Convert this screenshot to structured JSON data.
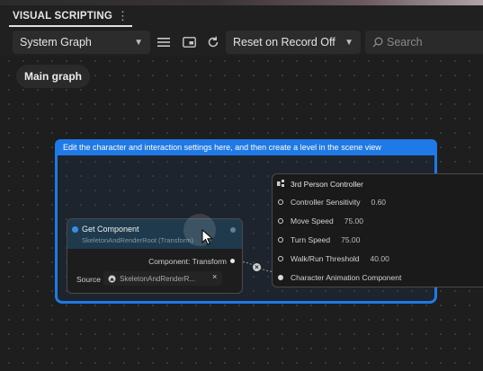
{
  "panel": {
    "title": "VISUAL SCRIPTING",
    "kebab": "⋮"
  },
  "toolbar": {
    "graph_select": "System Graph",
    "reset_select": "Reset on Record Off",
    "search_placeholder": "Search"
  },
  "breadcrumb": {
    "label": "Main graph"
  },
  "group": {
    "header": "Edit the character and interaction settings here, and then create a level in the scene view",
    "color": "#1f7ae8"
  },
  "node_get_component": {
    "title": "Get Component",
    "subtitle": "SkeletonAndRenderRoot (Transform)",
    "output_label": "Component: Transform",
    "source_label": "Source",
    "source_value": "SkeletonAndRenderR...",
    "clear": "×"
  },
  "node_controller": {
    "title": "3rd Person Controller",
    "rows": [
      {
        "label": "Controller Sensitivity",
        "value": "0.60"
      },
      {
        "label": "Move Speed",
        "value": "75.00"
      },
      {
        "label": "Turn Speed",
        "value": "75.00"
      },
      {
        "label": "Walk/Run Threshold",
        "value": "40.00"
      },
      {
        "label": "Character Animation Component",
        "value": ""
      }
    ]
  },
  "connector": {
    "break_symbol": "×"
  },
  "icons": [
    "kebab-icon",
    "menu-icon",
    "layout-icon",
    "refresh-icon",
    "search-icon",
    "chevron-down-icon",
    "flow-port-icon",
    "source-object-icon",
    "controller-node-icon",
    "cursor-icon"
  ],
  "colors": {
    "accent_blue": "#1f7ae8",
    "node_header": "#1e3a4c",
    "background": "#1e1e1e"
  }
}
